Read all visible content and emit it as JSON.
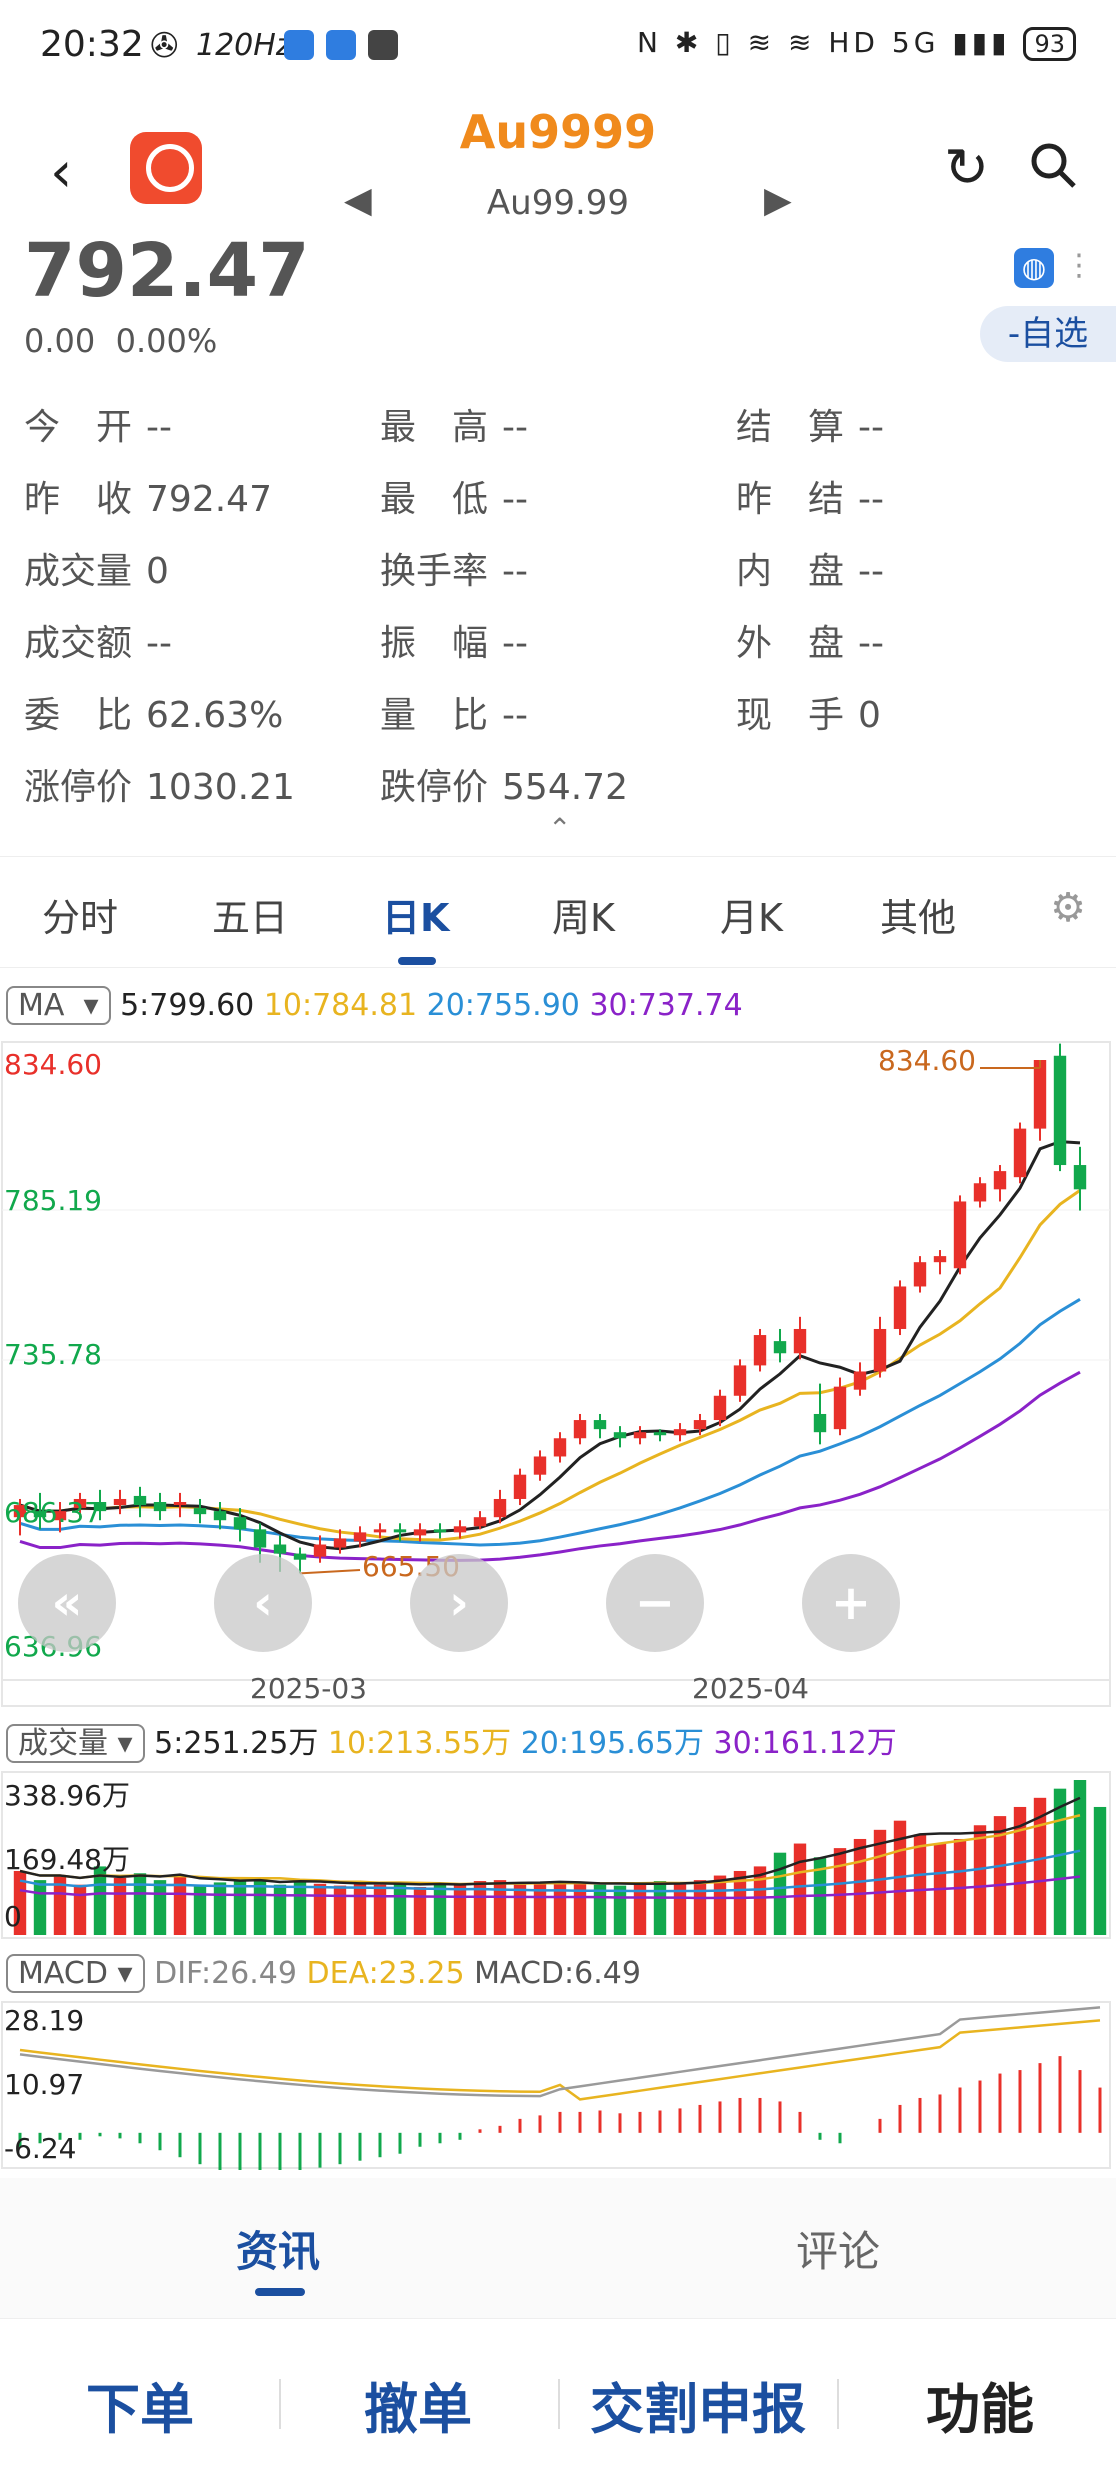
{
  "status_bar": {
    "time": "20:32",
    "refresh": "120Hz",
    "signal": "5G",
    "battery": "93"
  },
  "header": {
    "title": "Au9999",
    "subtitle": "Au99.99"
  },
  "quote": {
    "price": "792.47",
    "change": "0.00",
    "change_pct": "0.00%",
    "self_select": "-自选"
  },
  "fields": [
    {
      "label": "今　开",
      "value": "--"
    },
    {
      "label": "最　高",
      "value": "--"
    },
    {
      "label": "结　算",
      "value": "--"
    },
    {
      "label": "昨　收",
      "value": "792.47"
    },
    {
      "label": "最　低",
      "value": "--"
    },
    {
      "label": "昨　结",
      "value": "--"
    },
    {
      "label": "成交量",
      "value": "0"
    },
    {
      "label": "换手率",
      "value": "--"
    },
    {
      "label": "内　盘",
      "value": "--"
    },
    {
      "label": "成交额",
      "value": "--"
    },
    {
      "label": "振　幅",
      "value": "--"
    },
    {
      "label": "外　盘",
      "value": "--"
    },
    {
      "label": "委　比",
      "value": "62.63%"
    },
    {
      "label": "量　比",
      "value": "--"
    },
    {
      "label": "现　手",
      "value": "0"
    },
    {
      "label": "涨停价",
      "value": "1030.21"
    },
    {
      "label": "跌停价",
      "value": "554.72"
    }
  ],
  "period_tabs": [
    "分时",
    "五日",
    "日K",
    "周K",
    "月K",
    "其他"
  ],
  "ma_legend": {
    "selector": "MA",
    "ma5": "5:799.60",
    "ma10": "10:784.81",
    "ma20": "20:755.90",
    "ma30": "30:737.74"
  },
  "price_axis": {
    "top": "834.60",
    "mid1": "785.19",
    "mid2": "735.78",
    "mid3": "686.37",
    "bottom": "636.96"
  },
  "annotations": {
    "high": "834.60",
    "low": "665.50"
  },
  "date_axis": [
    "2025-03",
    "2025-04"
  ],
  "vol_legend": {
    "selector": "成交量",
    "ma5": "5:251.25万",
    "ma10": "10:213.55万",
    "ma20": "20:195.65万",
    "ma30": "30:161.12万"
  },
  "vol_axis": {
    "top": "338.96万",
    "mid": "169.48万",
    "bottom": "0"
  },
  "macd_legend": {
    "selector": "MACD",
    "dif": "DIF:26.49",
    "dea": "DEA:23.25",
    "macd": "MACD:6.49"
  },
  "macd_axis": {
    "top": "28.19",
    "mid": "10.97",
    "bottom": "-6.24"
  },
  "bottom_tabs": [
    "资讯",
    "评论"
  ],
  "actions": [
    "下单",
    "撤单",
    "交割申报",
    "功能"
  ],
  "colors": {
    "up": "#e8302a",
    "down": "#11a84c",
    "ma5": "#222222",
    "ma10": "#e8b420",
    "ma20": "#2a8fd6",
    "ma30": "#8a22c8",
    "accent": "#1b4fa0",
    "title": "#f08a1c"
  },
  "chart_data": {
    "type": "candlestick",
    "title": "Au9999 日K",
    "ylim": [
      636.96,
      834.6
    ],
    "x_ticks": [
      "2025-03",
      "2025-04"
    ],
    "candles": [
      [
        684,
        688,
        678,
        690
      ],
      [
        686,
        684,
        680,
        692
      ],
      [
        683,
        686,
        679,
        689
      ],
      [
        687,
        690,
        684,
        692
      ],
      [
        689,
        686,
        683,
        693
      ],
      [
        688,
        690,
        685,
        693
      ],
      [
        691,
        688,
        684,
        694
      ],
      [
        689,
        686,
        683,
        692
      ],
      [
        688,
        689,
        684,
        692
      ],
      [
        687,
        685,
        682,
        690
      ],
      [
        686,
        683,
        680,
        689
      ],
      [
        684,
        680,
        676,
        687
      ],
      [
        680,
        674,
        669,
        682
      ],
      [
        675,
        672,
        666,
        678
      ],
      [
        672,
        670,
        665.5,
        674
      ],
      [
        671,
        675,
        669,
        678
      ],
      [
        674,
        677,
        672,
        680
      ],
      [
        676,
        679,
        674,
        681
      ],
      [
        679,
        680,
        677,
        682
      ],
      [
        680,
        679,
        676,
        682
      ],
      [
        678,
        680,
        676,
        682
      ],
      [
        680,
        679,
        677,
        682
      ],
      [
        679,
        681,
        677,
        683
      ],
      [
        681,
        684,
        680,
        686
      ],
      [
        684,
        690,
        682,
        693
      ],
      [
        690,
        698,
        688,
        700
      ],
      [
        698,
        704,
        696,
        706
      ],
      [
        704,
        710,
        702,
        712
      ],
      [
        710,
        716,
        708,
        718
      ],
      [
        716,
        713,
        710,
        718
      ],
      [
        712,
        710,
        707,
        714
      ],
      [
        710,
        712,
        708,
        714
      ],
      [
        712,
        711,
        709,
        713
      ],
      [
        711,
        713,
        709,
        715
      ],
      [
        713,
        716,
        711,
        718
      ],
      [
        716,
        724,
        714,
        726
      ],
      [
        724,
        734,
        722,
        736
      ],
      [
        734,
        744,
        732,
        746
      ],
      [
        742,
        738,
        735,
        746
      ],
      [
        738,
        746,
        736,
        750
      ],
      [
        718,
        712,
        708,
        728
      ],
      [
        713,
        727,
        711,
        730
      ],
      [
        726,
        732,
        724,
        735
      ],
      [
        732,
        746,
        730,
        750
      ],
      [
        746,
        760,
        744,
        762
      ],
      [
        760,
        768,
        758,
        770
      ],
      [
        768,
        770,
        764,
        772
      ],
      [
        766,
        788,
        764,
        790
      ],
      [
        788,
        794,
        786,
        796
      ],
      [
        792,
        798,
        788,
        800
      ],
      [
        796,
        812,
        794,
        814
      ],
      [
        812,
        834.6,
        808,
        834.6
      ],
      [
        836,
        800,
        798,
        840
      ],
      [
        800,
        792,
        785,
        806
      ]
    ],
    "volume_wan": [
      140,
      120,
      130,
      110,
      150,
      125,
      135,
      120,
      130,
      110,
      115,
      120,
      125,
      110,
      118,
      112,
      108,
      116,
      110,
      115,
      105,
      112,
      110,
      118,
      120,
      110,
      115,
      118,
      112,
      110,
      108,
      112,
      118,
      115,
      120,
      130,
      140,
      150,
      180,
      200,
      170,
      190,
      210,
      230,
      250,
      220,
      200,
      210,
      240,
      260,
      280,
      300,
      320,
      338.96,
      280
    ],
    "macd_bars": [
      -2,
      -1.5,
      -1,
      -1,
      -0.5,
      -0.8,
      -1.5,
      -2.5,
      -3.5,
      -4.5,
      -5.5,
      -6,
      -6.24,
      -6,
      -5.5,
      -5,
      -4.5,
      -4,
      -3.5,
      -3,
      -2,
      -1.5,
      -1,
      0.5,
      1,
      2,
      2.5,
      3,
      3,
      3.2,
      2.8,
      3,
      3.2,
      3.5,
      4,
      4.5,
      5,
      5,
      4.5,
      3,
      -1,
      -1.5,
      0,
      2,
      4,
      5,
      5.5,
      6.5,
      7.5,
      8.5,
      9,
      10,
      11,
      9,
      6.49
    ]
  }
}
